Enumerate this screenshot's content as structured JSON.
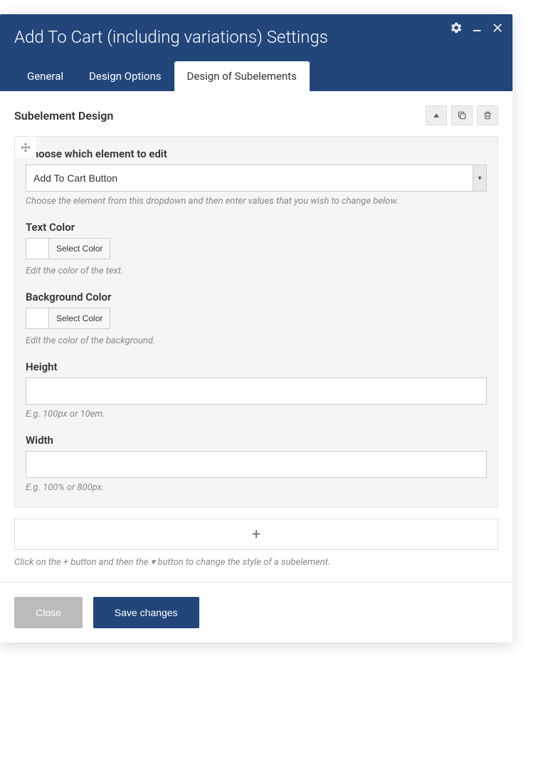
{
  "header": {
    "title": "Add To Cart (including variations) Settings"
  },
  "tabs": [
    {
      "label": "General",
      "active": false
    },
    {
      "label": "Design Options",
      "active": false
    },
    {
      "label": "Design of Subelements",
      "active": true
    }
  ],
  "section": {
    "title": "Subelement Design"
  },
  "fields": {
    "element_choose": {
      "label": "Choose which element to edit",
      "value": "Add To Cart Button",
      "help": "Choose the element from this dropdown and then enter values that you wish to change below."
    },
    "text_color": {
      "label": "Text Color",
      "button": "Select Color",
      "help": "Edit the color of the text."
    },
    "background_color": {
      "label": "Background Color",
      "button": "Select Color",
      "help": "Edit the color of the background."
    },
    "height": {
      "label": "Height",
      "value": "",
      "help": "E.g. 100px or 10em."
    },
    "width": {
      "label": "Width",
      "value": "",
      "help": "E.g. 100% or 800px."
    }
  },
  "add_row_help": "Click on the + button and then the  ▾  button to change the style of a subelement.",
  "footer": {
    "close": "Close",
    "save": "Save changes"
  }
}
